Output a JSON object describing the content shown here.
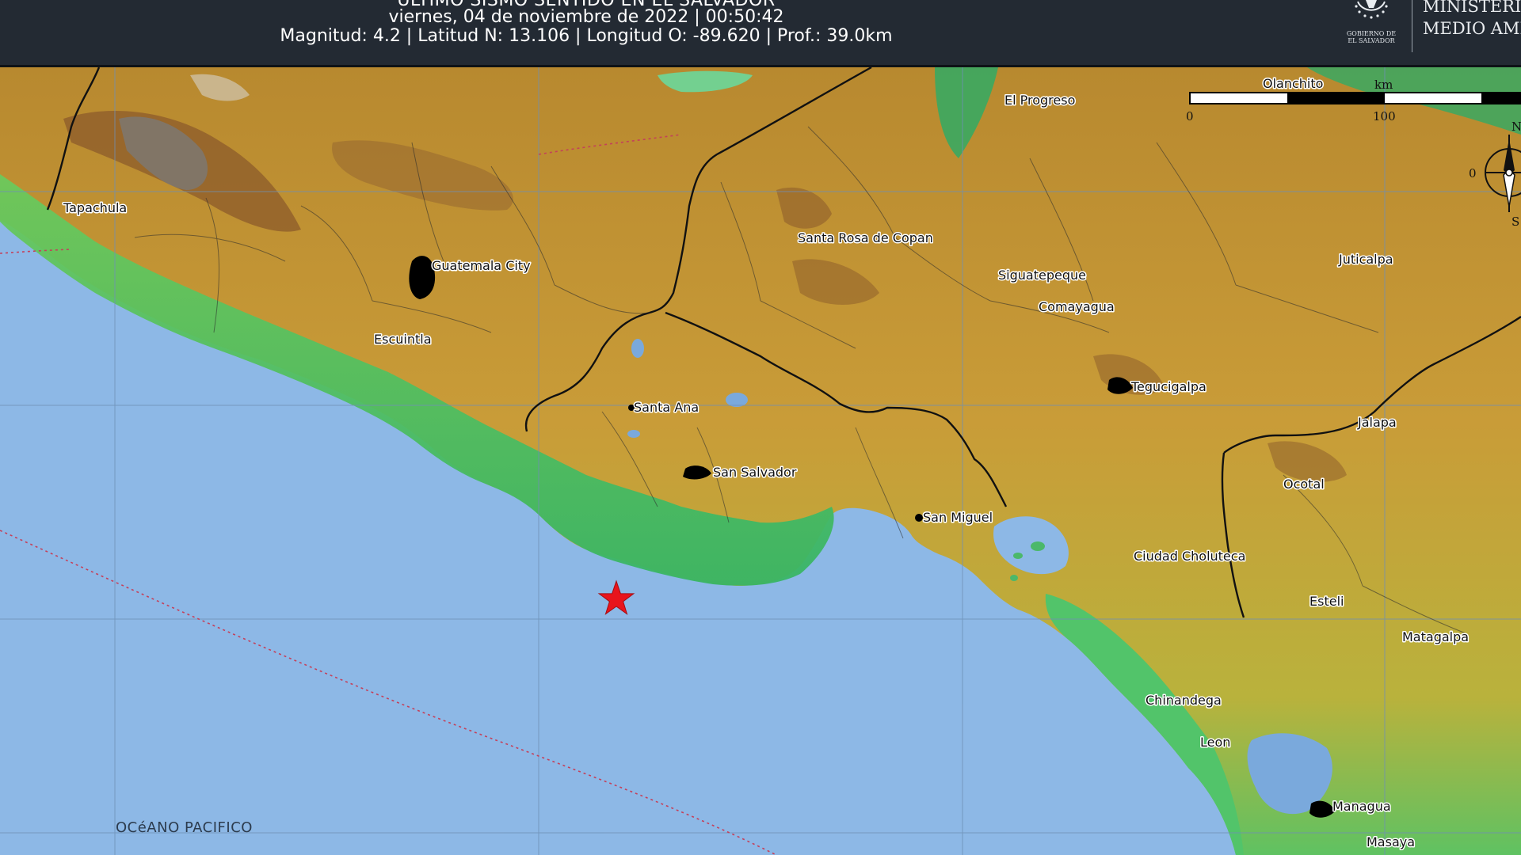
{
  "header": {
    "title": "ULTIMO SISMO SENTIDO EN EL SALVADOR",
    "date_line": "viernes, 04 de noviembre de 2022 | 00:50:42",
    "info_line": "Magnitud: 4.2 | Latitud N: 13.106 | Longitud O: -89.620 | Prof.: 39.0km",
    "logo_caption_1": "GOBIERNO DE",
    "logo_caption_2": "EL SALVADOR",
    "ministry_1": "MINISTERIO",
    "ministry_2": "MEDIO AME"
  },
  "earthquake": {
    "magnitude": 4.2,
    "latitude_n": 13.106,
    "longitude": -89.62,
    "depth_km": 39.0,
    "marker_color": "#e8141c"
  },
  "scale_bar": {
    "unit": "km",
    "tick_0": "0",
    "tick_100": "100"
  },
  "compass": {
    "north": "N",
    "east_tick": "0",
    "south": "S"
  },
  "ocean_label": "OCéANO PACIFICO",
  "cities": {
    "tapachula": "Tapachula",
    "guatemala_city": "Guatemala City",
    "escuintla": "Escuintla",
    "santa_ana": "Santa Ana",
    "san_salvador": "San Salvador",
    "san_miguel": "San Miguel",
    "santa_rosa_de_copan": "Santa Rosa de Copan",
    "el_progreso": "El Progreso",
    "olanchito": "Olanchito",
    "siguatepeque": "Siguatepeque",
    "comayagua": "Comayagua",
    "tegucigalpa": "Tegucigalpa",
    "juticalpa": "Juticalpa",
    "jalapa": "Jalapa",
    "ocotal": "Ocotal",
    "ciudad_choluteca": "Ciudad Choluteca",
    "esteli": "Esteli",
    "matagalpa": "Matagalpa",
    "chinandega": "Chinandega",
    "leon": "Leon",
    "managua": "Managua",
    "masaya": "Masaya"
  },
  "colors": {
    "ocean": "#8db8e6",
    "lowland": "#4fc46f",
    "highland": "#cfa33a",
    "mountain": "#8a5a2a",
    "header": "#232a33",
    "marker": "#e8141c"
  }
}
